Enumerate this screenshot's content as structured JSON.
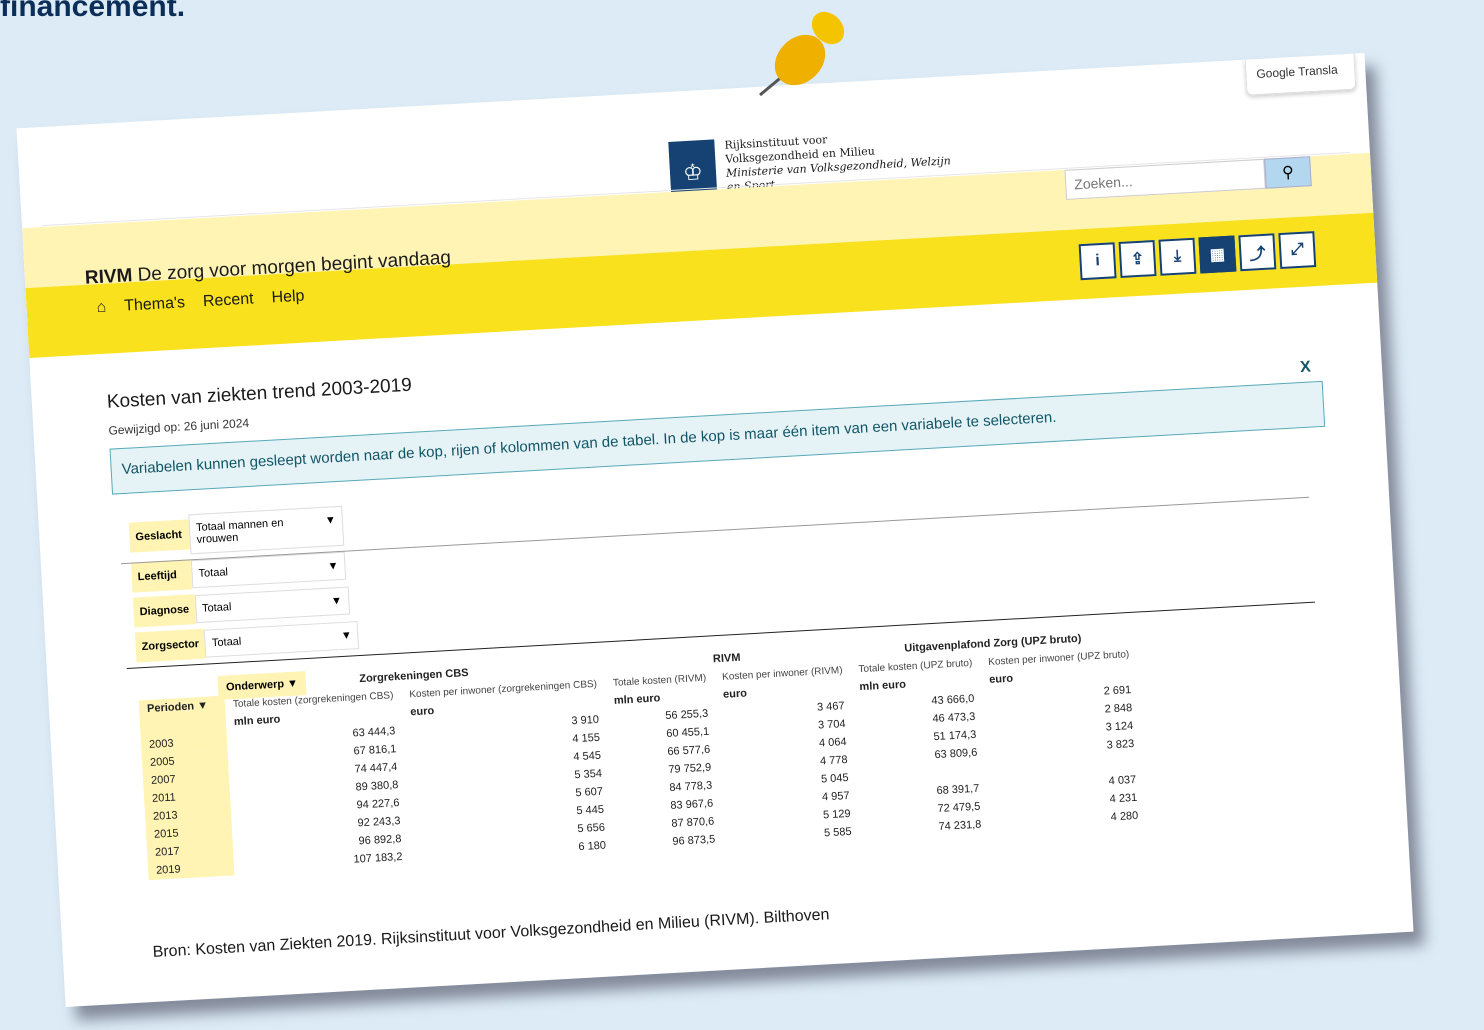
{
  "caption_top": "financement.",
  "google_translate": "Google Transla",
  "logo": {
    "line1": "Rijksinstituut voor",
    "line2": "Volksgezondheid en Milieu",
    "line3": "Ministerie van Volksgezondheid, Welzijn",
    "line4": "en Sport"
  },
  "header": {
    "brand": "RIVM",
    "tagline": "De zorg voor morgen begint vandaag",
    "nav": [
      "Thema's",
      "Recent",
      "Help"
    ]
  },
  "search": {
    "placeholder": "Zoeken..."
  },
  "toolbar": {
    "info": "i",
    "share": "⇪",
    "download": "⤓",
    "table": "▦",
    "chart": "⤴",
    "expand": "⤢"
  },
  "page": {
    "title": "Kosten van ziekten trend 2003-2019",
    "modified": "Gewijzigd op: 26 juni 2024",
    "notice": "Variabelen kunnen gesleept worden naar de kop, rijen of kolommen van de tabel. In de kop is maar één item van een variabele te selecteren.",
    "close": "X"
  },
  "filters": [
    {
      "label": "Geslacht",
      "value": "Totaal mannen en vrouwen"
    },
    {
      "label": "Leeftijd",
      "value": "Totaal"
    },
    {
      "label": "Diagnose",
      "value": "Totaal"
    },
    {
      "label": "Zorgsector",
      "value": "Totaal"
    }
  ],
  "table": {
    "onderwerp": "Onderwerp",
    "perioden": "Perioden",
    "groups": [
      "Zorgrekeningen CBS",
      "RIVM",
      "Uitgavenplafond Zorg (UPZ bruto)"
    ],
    "columns": [
      "Totale kosten (zorgrekeningen CBS)",
      "Kosten per inwoner (zorgrekeningen CBS)",
      "Totale kosten (RIVM)",
      "Kosten per inwoner (RIVM)",
      "Totale kosten (UPZ bruto)",
      "Kosten per inwoner (UPZ bruto)"
    ],
    "units": [
      "mln euro",
      "euro",
      "mln euro",
      "euro",
      "mln euro",
      "euro"
    ],
    "rows": [
      {
        "year": "2003",
        "v": [
          "63 444,3",
          "3 910",
          "56 255,3",
          "3 467",
          "43 666,0",
          "2 691"
        ]
      },
      {
        "year": "2005",
        "v": [
          "67 816,1",
          "4 155",
          "60 455,1",
          "3 704",
          "46 473,3",
          "2 848"
        ]
      },
      {
        "year": "2007",
        "v": [
          "74 447,4",
          "4 545",
          "66 577,6",
          "4 064",
          "51 174,3",
          "3 124"
        ]
      },
      {
        "year": "2011",
        "v": [
          "89 380,8",
          "5 354",
          "79 752,9",
          "4 778",
          "63 809,6",
          "3 823"
        ]
      },
      {
        "year": "2013",
        "v": [
          "94 227,6",
          "5 607",
          "84 778,3",
          "5 045",
          "",
          ""
        ]
      },
      {
        "year": "2015",
        "v": [
          "92 243,3",
          "5 445",
          "83 967,6",
          "4 957",
          "68 391,7",
          "4 037"
        ]
      },
      {
        "year": "2017",
        "v": [
          "96 892,8",
          "5 656",
          "87 870,6",
          "5 129",
          "72 479,5",
          "4 231"
        ]
      },
      {
        "year": "2019",
        "v": [
          "107 183,2",
          "6 180",
          "96 873,5",
          "5 585",
          "74 231,8",
          "4 280"
        ]
      }
    ]
  },
  "source": "Bron: Kosten van Ziekten 2019. Rijksinstituut voor Volksgezondheid en Milieu (RIVM). Bilthoven"
}
